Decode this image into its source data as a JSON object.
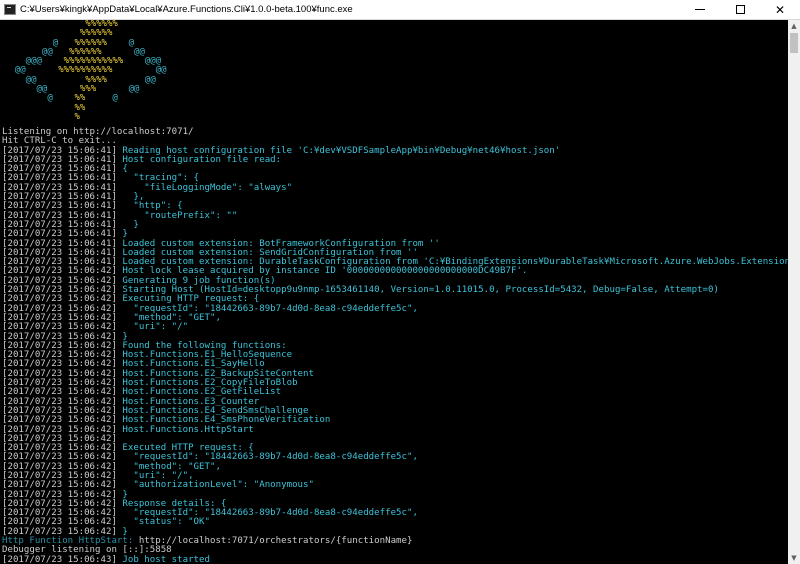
{
  "window": {
    "title": "C:¥Users¥kingk¥AppData¥Local¥Azure.Functions.Cli¥1.0.0-beta.100¥func.exe",
    "minimize_label": "",
    "maximize_label": "",
    "close_label": "✕"
  },
  "logo": {
    "rows": [
      {
        "c1": "",
        "y": "               %%%%%%",
        "c2": ""
      },
      {
        "c1": "",
        "y": "              %%%%%%",
        "c2": ""
      },
      {
        "c1": "         @   ",
        "y": "%%%%%%",
        "c2": "    @"
      },
      {
        "c1": "       @@   ",
        "y": "%%%%%%",
        "c2": "      @@"
      },
      {
        "c1": "    @@@    ",
        "y": "%%%%%%%%%%%",
        "c2": "    @@@"
      },
      {
        "c1": "  @@      ",
        "y": "%%%%%%%%%%",
        "c2": "        @@"
      },
      {
        "c1": "    @@         ",
        "y": "%%%%",
        "c2": "       @@"
      },
      {
        "c1": "      @@      ",
        "y": "%%%",
        "c2": "      @@"
      },
      {
        "c1": "        @    ",
        "y": "%%",
        "c2": "     @"
      },
      {
        "c1": "",
        "y": "             %%",
        "c2": ""
      },
      {
        "c1": "",
        "y": "             %",
        "c2": ""
      }
    ]
  },
  "console": {
    "lines": [
      {
        "ts": "",
        "msg": "Listening on http://localhost:7071/",
        "cls": "url"
      },
      {
        "ts": "",
        "msg": "Hit CTRL-C to exit...",
        "cls": "url"
      },
      {
        "ts": "[2017/07/23 15:06:41] ",
        "msg": "Reading host configuration file 'C:¥dev¥VSDFSampleApp¥bin¥Debug¥net46¥host.json'",
        "cls": "msg"
      },
      {
        "ts": "[2017/07/23 15:06:41] ",
        "msg": "Host configuration file read:",
        "cls": "msg"
      },
      {
        "ts": "[2017/07/23 15:06:41] ",
        "msg": "{",
        "cls": "msg"
      },
      {
        "ts": "[2017/07/23 15:06:41] ",
        "msg": "  \"tracing\": {",
        "cls": "msg"
      },
      {
        "ts": "[2017/07/23 15:06:41] ",
        "msg": "    \"fileLoggingMode\": \"always\"",
        "cls": "msg"
      },
      {
        "ts": "[2017/07/23 15:06:41] ",
        "msg": "  },",
        "cls": "msg"
      },
      {
        "ts": "[2017/07/23 15:06:41] ",
        "msg": "  \"http\": {",
        "cls": "msg"
      },
      {
        "ts": "[2017/07/23 15:06:41] ",
        "msg": "    \"routePrefix\": \"\"",
        "cls": "msg"
      },
      {
        "ts": "[2017/07/23 15:06:41] ",
        "msg": "  }",
        "cls": "msg"
      },
      {
        "ts": "[2017/07/23 15:06:41] ",
        "msg": "}",
        "cls": "msg"
      },
      {
        "ts": "[2017/07/23 15:06:41] ",
        "msg": "Loaded custom extension: BotFrameworkConfiguration from ''",
        "cls": "msg"
      },
      {
        "ts": "[2017/07/23 15:06:41] ",
        "msg": "Loaded custom extension: SendGridConfiguration from ''",
        "cls": "msg"
      },
      {
        "ts": "[2017/07/23 15:06:41] ",
        "msg": "Loaded custom extension: DurableTaskConfiguration from 'C:¥BindingExtensions¥DurableTask¥Microsoft.Azure.WebJobs.Extensions.DurableTask.dll'",
        "cls": "msg"
      },
      {
        "ts": "[2017/07/23 15:06:42] ",
        "msg": "Host lock lease acquired by instance ID '000000000000000000000000DC49B7F'.",
        "cls": "msg"
      },
      {
        "ts": "[2017/07/23 15:06:42] ",
        "msg": "Generating 9 job function(s)",
        "cls": "msg"
      },
      {
        "ts": "[2017/07/23 15:06:42] ",
        "msg": "Starting Host (HostId=desktopp9u9nmp-1653461140, Version=1.0.11015.0, ProcessId=5432, Debug=False, Attempt=0)",
        "cls": "msg"
      },
      {
        "ts": "[2017/07/23 15:06:42] ",
        "msg": "Executing HTTP request: {",
        "cls": "msg"
      },
      {
        "ts": "[2017/07/23 15:06:42] ",
        "msg": "  \"requestId\": \"18442663-89b7-4d0d-8ea8-c94eddeffe5c\",",
        "cls": "msg"
      },
      {
        "ts": "[2017/07/23 15:06:42] ",
        "msg": "  \"method\": \"GET\",",
        "cls": "msg"
      },
      {
        "ts": "[2017/07/23 15:06:42] ",
        "msg": "  \"uri\": \"/\"",
        "cls": "msg"
      },
      {
        "ts": "[2017/07/23 15:06:42] ",
        "msg": "}",
        "cls": "msg"
      },
      {
        "ts": "[2017/07/23 15:06:42] ",
        "msg": "Found the following functions:",
        "cls": "msg"
      },
      {
        "ts": "[2017/07/23 15:06:42] ",
        "msg": "Host.Functions.E1_HelloSequence",
        "cls": "msg"
      },
      {
        "ts": "[2017/07/23 15:06:42] ",
        "msg": "Host.Functions.E1_SayHello",
        "cls": "msg"
      },
      {
        "ts": "[2017/07/23 15:06:42] ",
        "msg": "Host.Functions.E2_BackupSiteContent",
        "cls": "msg"
      },
      {
        "ts": "[2017/07/23 15:06:42] ",
        "msg": "Host.Functions.E2_CopyFileToBlob",
        "cls": "msg"
      },
      {
        "ts": "[2017/07/23 15:06:42] ",
        "msg": "Host.Functions.E2_GetFileList",
        "cls": "msg"
      },
      {
        "ts": "[2017/07/23 15:06:42] ",
        "msg": "Host.Functions.E3_Counter",
        "cls": "msg"
      },
      {
        "ts": "[2017/07/23 15:06:42] ",
        "msg": "Host.Functions.E4_SendSmsChallenge",
        "cls": "msg"
      },
      {
        "ts": "[2017/07/23 15:06:42] ",
        "msg": "Host.Functions.E4_SmsPhoneVerification",
        "cls": "msg"
      },
      {
        "ts": "[2017/07/23 15:06:42] ",
        "msg": "Host.Functions.HttpStart",
        "cls": "msg"
      },
      {
        "ts": "[2017/07/23 15:06:42] ",
        "msg": "",
        "cls": "msg"
      },
      {
        "ts": "[2017/07/23 15:06:42] ",
        "msg": "Executed HTTP request: {",
        "cls": "msg"
      },
      {
        "ts": "[2017/07/23 15:06:42] ",
        "msg": "  \"requestId\": \"18442663-89b7-4d0d-8ea8-c94eddeffe5c\",",
        "cls": "msg"
      },
      {
        "ts": "[2017/07/23 15:06:42] ",
        "msg": "  \"method\": \"GET\",",
        "cls": "msg"
      },
      {
        "ts": "[2017/07/23 15:06:42] ",
        "msg": "  \"uri\": \"/\",",
        "cls": "msg"
      },
      {
        "ts": "[2017/07/23 15:06:42] ",
        "msg": "  \"authorizationLevel\": \"Anonymous\"",
        "cls": "msg"
      },
      {
        "ts": "[2017/07/23 15:06:42] ",
        "msg": "}",
        "cls": "msg"
      },
      {
        "ts": "[2017/07/23 15:06:42] ",
        "msg": "Response details: {",
        "cls": "msg"
      },
      {
        "ts": "[2017/07/23 15:06:42] ",
        "msg": "  \"requestId\": \"18442663-89b7-4d0d-8ea8-c94eddeffe5c\",",
        "cls": "msg"
      },
      {
        "ts": "[2017/07/23 15:06:42] ",
        "msg": "  \"status\": \"OK\"",
        "cls": "msg"
      },
      {
        "ts": "[2017/07/23 15:06:42] ",
        "msg": "}",
        "cls": "msg"
      },
      {
        "ts": "",
        "msg": "Http Function HttpStart: ",
        "cls": "hl",
        "extra": "http://localhost:7071/orchestrators/{functionName}"
      },
      {
        "ts": "",
        "msg": "Debugger listening on [::]:5858",
        "cls": "url"
      },
      {
        "ts": "[2017/07/23 15:06:43] ",
        "msg": "Job host started",
        "cls": "msg"
      }
    ]
  },
  "scrollbar": {
    "up_glyph": "▲",
    "down_glyph": "▼"
  },
  "colors": {
    "background": "#000000",
    "timestamp": "#cccccc",
    "message": "#3cc3d8",
    "logo_yellow": "#f0d33a",
    "logo_cyan": "#3fb6c8"
  }
}
